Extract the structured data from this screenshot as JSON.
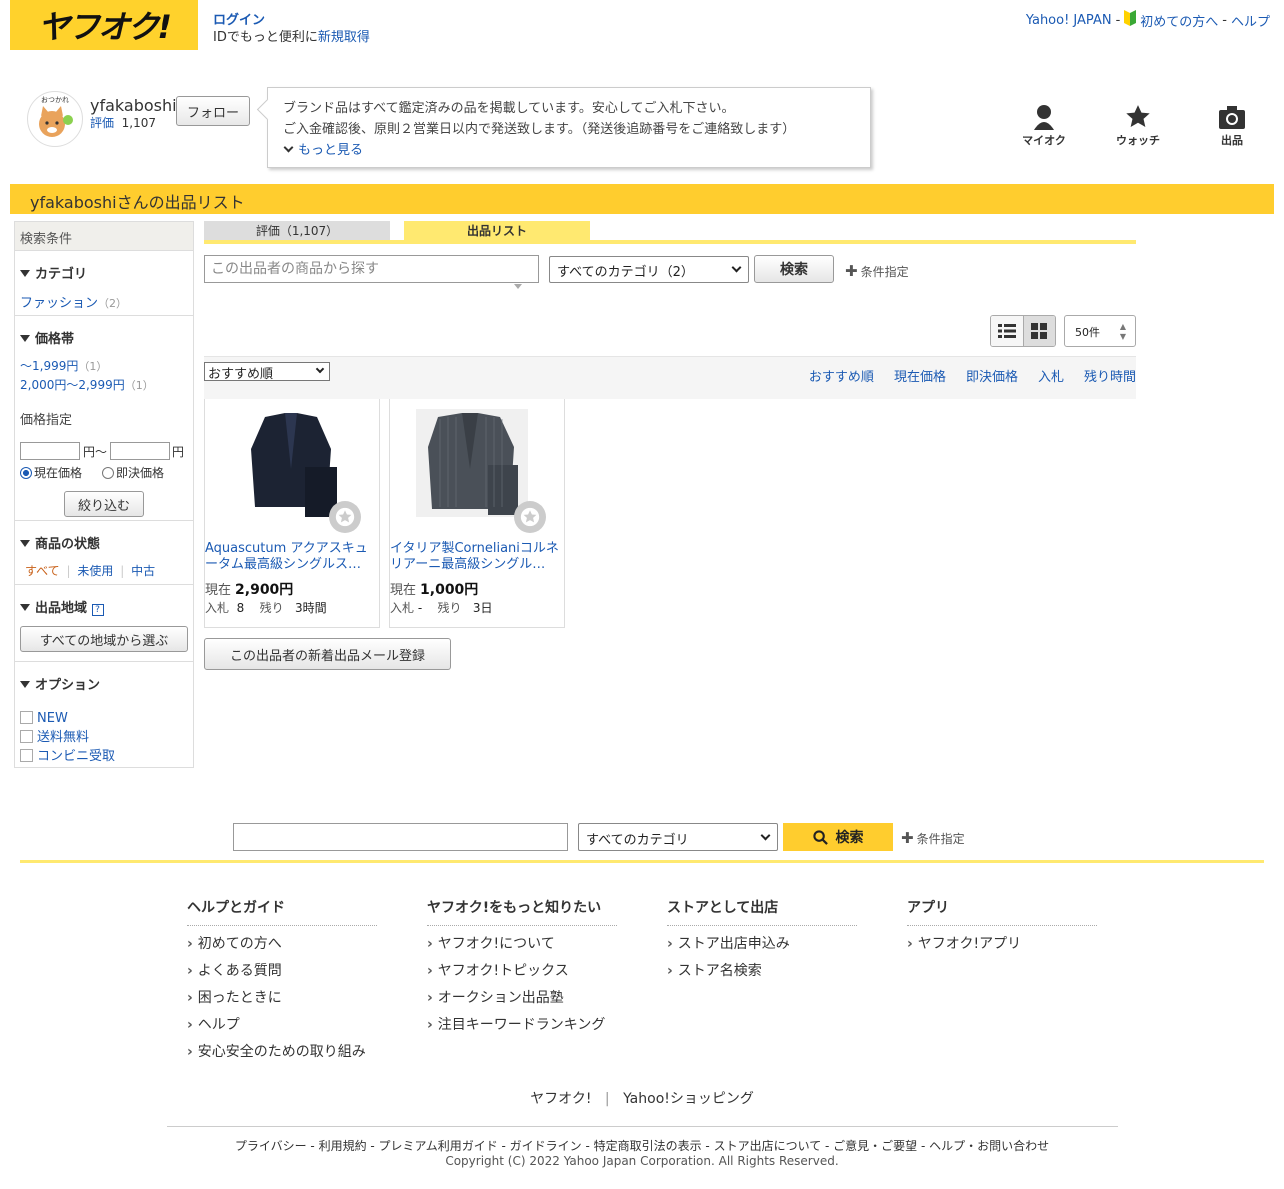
{
  "header": {
    "logo_text": "ヤフオク!",
    "login": "ログイン",
    "id_prefix": "IDでもっと便利に",
    "register": "新規取得",
    "yahoo_japan": "Yahoo! JAPAN",
    "first_time": "初めての方へ",
    "help": "ヘルプ",
    "sep": "-"
  },
  "seller": {
    "name": "yfakaboshi",
    "rating_label": "評価",
    "rating_value": "1,107",
    "follow": "フォロー",
    "notice_line1": "ブランド品はすべて鑑定済みの品を掲載しています。安心してご入札下さい。",
    "notice_line2": "ご入金確認後、原則２営業日以内で発送致します。（発送後追跡番号をご連絡致します）",
    "more": "もっと見る"
  },
  "quicknav": {
    "myauc": "マイオク",
    "watch": "ウォッチ",
    "sell": "出品"
  },
  "title_bar": "yfakaboshiさんの出品リスト",
  "sidebar": {
    "heading": "検索条件",
    "category_title": "カテゴリ",
    "category_item": "ファッション",
    "category_count": "（2）",
    "price_title": "価格帯",
    "price1": "〜1,999円",
    "price1_count": "（1）",
    "price2": "2,000円〜2,999円",
    "price2_count": "（1）",
    "price_specify": "価格指定",
    "yen_from": "円～",
    "yen_to": "円",
    "radio_current": "現在価格",
    "radio_buynow": "即決価格",
    "narrow_btn": "絞り込む",
    "condition_title": "商品の状態",
    "cond_all": "すべて",
    "cond_new": "未使用",
    "cond_used": "中古",
    "region_title": "出品地域",
    "region_help": "?",
    "region_btn": "すべての地域から選ぶ",
    "option_title": "オプション",
    "opt_new": "NEW",
    "opt_free": "送料無料",
    "opt_conv": "コンビニ受取"
  },
  "tabs": {
    "rating": "評価（1,107）",
    "listing": "出品リスト"
  },
  "search": {
    "placeholder": "この出品者の商品から探す",
    "category": "すべてのカテゴリ（2）",
    "button": "検索",
    "condition": "条件指定"
  },
  "view": {
    "per_page": "50件"
  },
  "sort": {
    "selected": "おすすめ順",
    "links": [
      "おすすめ順",
      "現在価格",
      "即決価格",
      "入札",
      "残り時間"
    ]
  },
  "items": [
    {
      "title": "Aquascutum アクアスキュータム最高級シングルス…",
      "price_label": "現在",
      "price": "2,900円",
      "bids_label": "入札",
      "bids": "8",
      "remain_label": "残り",
      "remain": "3時間"
    },
    {
      "title": "イタリア製Cornelianiコルネリアーニ最高級シングル…",
      "price_label": "現在",
      "price": "1,000円",
      "bids_label": "入札",
      "bids": "-",
      "remain_label": "残り",
      "remain": "3日"
    }
  ],
  "mail_btn": "この出品者の新着出品メール登録",
  "bottom_search": {
    "category": "すべてのカテゴリ",
    "button": "検索",
    "condition": "条件指定"
  },
  "footer": {
    "cols": [
      {
        "title": "ヘルプとガイド",
        "items": [
          "初めての方へ",
          "よくある質問",
          "困ったときに",
          "ヘルプ",
          "安心安全のための取り組み"
        ]
      },
      {
        "title": "ヤフオク!をもっと知りたい",
        "items": [
          "ヤフオク!について",
          "ヤフオク!トピックス",
          "オークション出品塾",
          "注目キーワードランキング"
        ]
      },
      {
        "title": "ストアとして出店",
        "items": [
          "ストア出店申込み",
          "ストア名検索"
        ]
      },
      {
        "title": "アプリ",
        "items": [
          "ヤフオク!アプリ"
        ]
      }
    ],
    "service1": "ヤフオク!",
    "service2": "Yahoo!ショッピング",
    "legal": "プライバシー - 利用規約 - プレミアム利用ガイド - ガイドライン - 特定商取引法の表示 - ストア出店について - ご意見・ご要望 - ヘルプ・お問い合わせ",
    "copyright": "Copyright (C) 2022 Yahoo Japan Corporation. All Rights Reserved."
  },
  "colors": {
    "brand_yellow": "#ffcd2e",
    "link_blue": "#1b5ab3",
    "tab_yellow": "#ffe970"
  }
}
